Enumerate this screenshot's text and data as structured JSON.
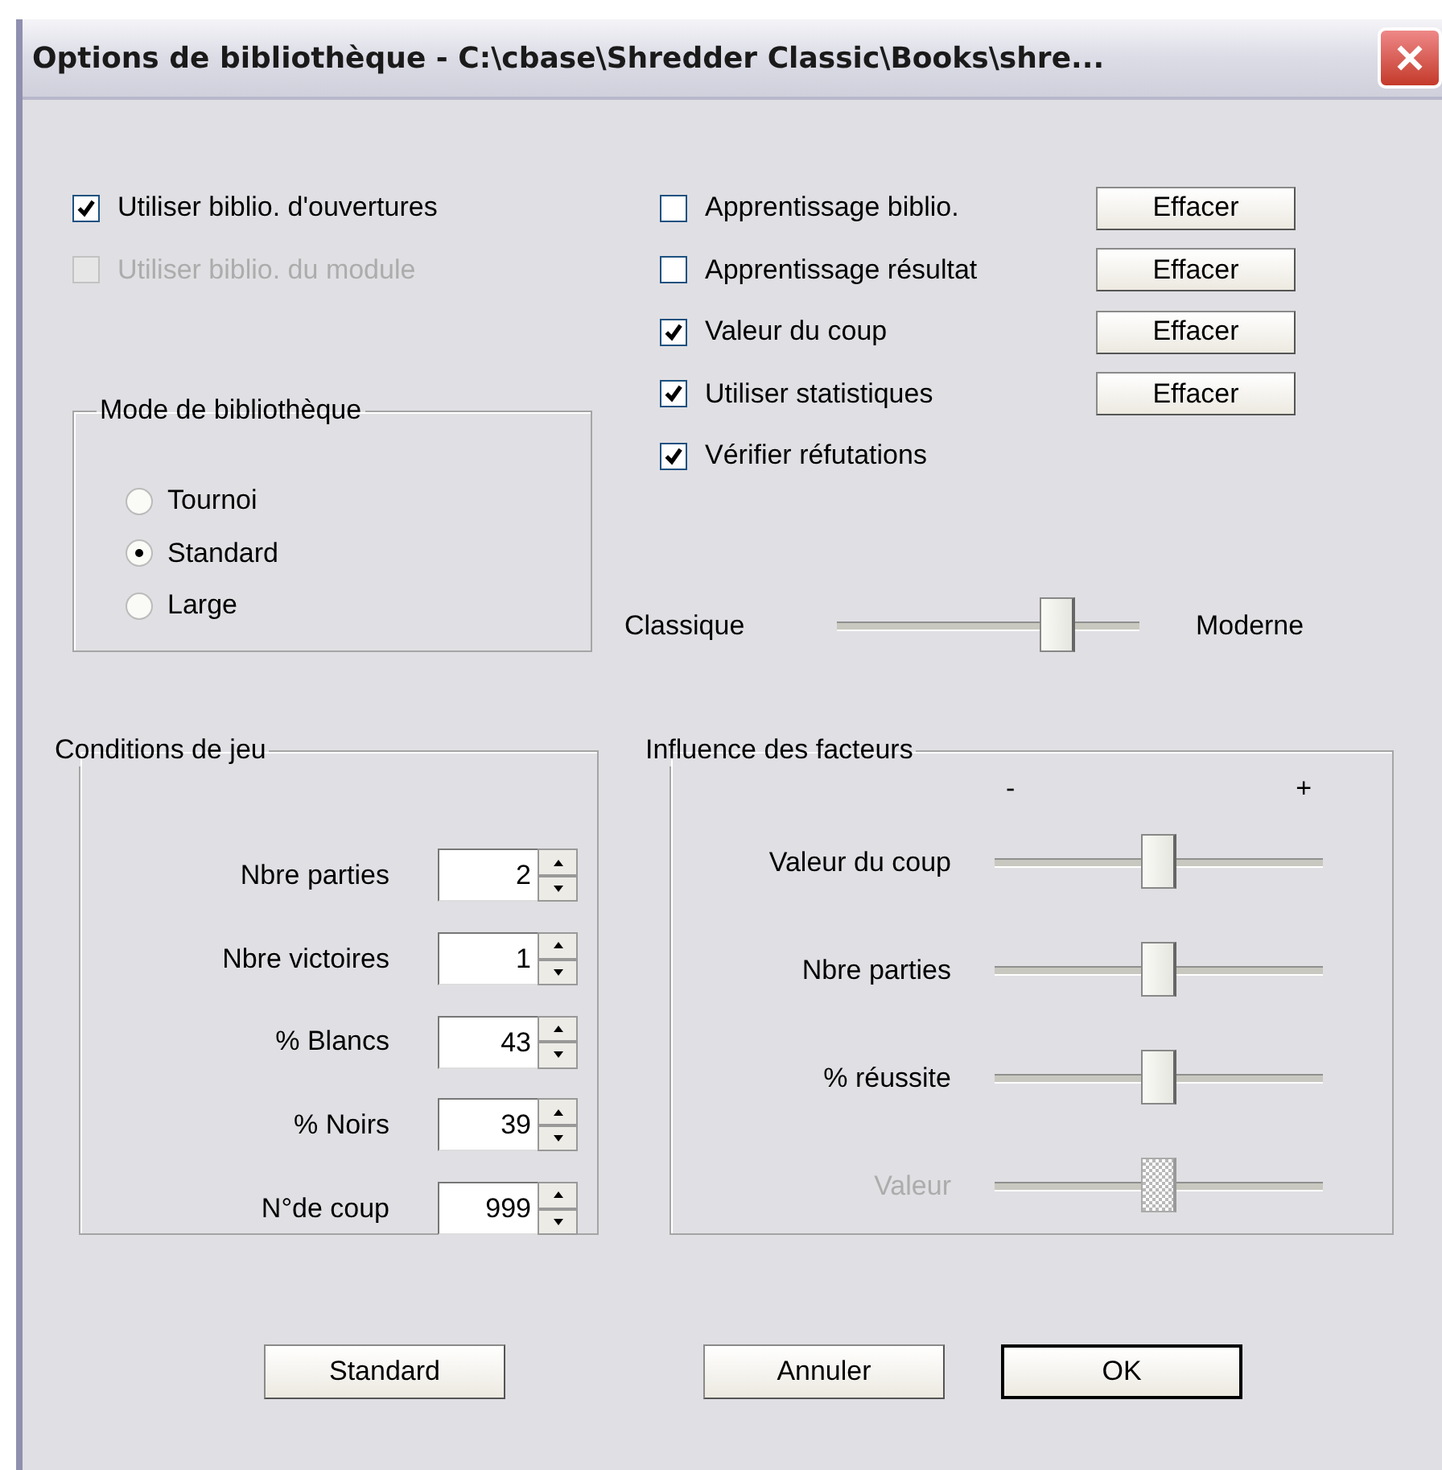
{
  "window": {
    "title": "Options de bibliothèque - C:\\cbase\\Shredder Classic\\Books\\shre..."
  },
  "left_options": [
    {
      "label": "Utiliser biblio. d'ouvertures",
      "checked": true,
      "disabled": false
    },
    {
      "label": "Utiliser biblio. du module",
      "checked": false,
      "disabled": true
    }
  ],
  "right_options": [
    {
      "label": "Apprentissage biblio.",
      "checked": false,
      "button": "Effacer"
    },
    {
      "label": "Apprentissage résultat",
      "checked": false,
      "button": "Effacer"
    },
    {
      "label": "Valeur du coup",
      "checked": true,
      "button": "Effacer"
    },
    {
      "label": "Utiliser statistiques",
      "checked": true,
      "button": "Effacer"
    },
    {
      "label": "Vérifier réfutations",
      "checked": true
    }
  ],
  "library_mode": {
    "title": "Mode de bibliothèque",
    "options": [
      {
        "label": "Tournoi",
        "selected": false
      },
      {
        "label": "Standard",
        "selected": true
      },
      {
        "label": "Large",
        "selected": false
      }
    ]
  },
  "style_slider": {
    "left_label": "Classique",
    "right_label": "Moderne",
    "level": 0.73
  },
  "game_conditions": {
    "title": "Conditions de jeu",
    "fields": [
      {
        "label": "Nbre parties",
        "value": "2"
      },
      {
        "label": "Nbre victoires",
        "value": "1"
      },
      {
        "label": "% Blancs",
        "value": "43"
      },
      {
        "label": "% Noirs",
        "value": "39"
      },
      {
        "label": "N°de coup",
        "value": "999"
      }
    ]
  },
  "factor_influence": {
    "title": "Influence des facteurs",
    "min_label": "-",
    "max_label": "+",
    "sliders": [
      {
        "label": "Valeur du coup",
        "level": 0.5,
        "disabled": false
      },
      {
        "label": "Nbre parties",
        "level": 0.5,
        "disabled": false
      },
      {
        "label": "% réussite",
        "level": 0.5,
        "disabled": false
      },
      {
        "label": "Valeur",
        "level": 0.5,
        "disabled": true
      }
    ]
  },
  "buttons": [
    {
      "label": "Standard",
      "default": false
    },
    {
      "label": "Annuler",
      "default": false
    },
    {
      "label": "OK",
      "default": true
    }
  ]
}
